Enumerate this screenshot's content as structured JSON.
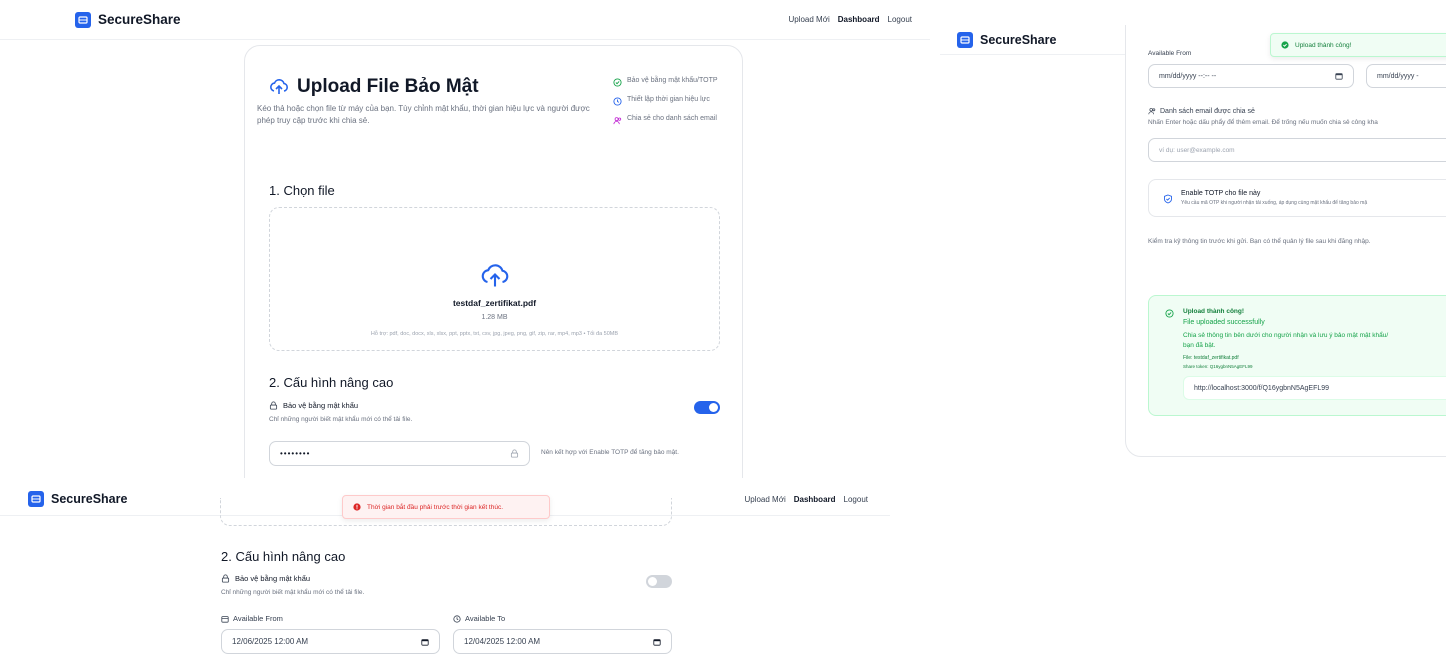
{
  "app": {
    "brand": "SecureShare"
  },
  "nav": {
    "upload": "Upload Mới",
    "dashboard": "Dashboard",
    "logout": "Logout"
  },
  "page": {
    "title": "Upload File Bảo Mật",
    "description": "Kéo thả hoặc chọn file từ máy của bạn. Tùy chỉnh mật khẩu, thời gian hiệu lực và người được phép truy cập trước khi chia sẻ.",
    "features": [
      {
        "icon": "shield-check-icon",
        "text": "Bảo vệ bằng mật khẩu/TOTP"
      },
      {
        "icon": "clock-icon",
        "text": "Thiết lập thời gian hiệu lực"
      },
      {
        "icon": "users-icon",
        "text": "Chia sẻ cho danh sách email"
      }
    ]
  },
  "file_section": {
    "heading": "1. Chọn file",
    "filename": "testdaf_zertifikat.pdf",
    "filesize": "1.28 MB",
    "support": "Hỗ trợ: pdf, doc, docx, xls, xlsx, ppt, pptx, txt, csv, jpg, jpeg, png, gif, zip, rar, mp4, mp3 • Tối đa 50MB"
  },
  "advanced": {
    "heading": "2. Cấu hình nâng cao",
    "password_label": "Bảo vệ bằng mật khẩu",
    "password_hint": "Chỉ những người biết mật khẩu mới có thể tải file.",
    "password_value": "••••••••",
    "password_tip": "Nên kết hợp với Enable TOTP để tăng bảo mật.",
    "password_enabled": true
  },
  "panel2": {
    "available_from_label": "Available From",
    "from_placeholder": "mm/dd/yyyy --:-- --",
    "to_placeholder": "mm/dd/yyyy -",
    "email_label": "Danh sách email được chia sẻ",
    "email_hint": "Nhấn Enter hoặc dấu phẩy để thêm email. Để trống nếu muốn chia sẻ công kha",
    "email_placeholder": "ví dụ: user@example.com",
    "totp_title": "Enable TOTP cho file này",
    "totp_desc": "Yêu cầu mã OTP khi người nhận tải xuống, áp dụng cùng mật khẩu để tăng bảo mậ",
    "review_note": "Kiểm tra kỹ thông tin trước khi gửi. Bạn có thể quản lý file sau khi đăng nhập.",
    "success": {
      "title": "Upload thành công!",
      "subtitle": "File uploaded successfully",
      "info": "Chia sẻ thông tin bên dưới cho người nhận và lưu ý bảo mật mật khẩu/",
      "info2": "bạn đã bật.",
      "file_line": "File: testdaf_zertifikat.pdf",
      "token_line": "Share token: Q16ygbnN5AgEFL99",
      "link": "http://localhost:3000/f/Q16ygbnN5AgEFL99"
    },
    "toast": "Upload thành công!"
  },
  "panel3": {
    "toast": "Thời gian bắt đầu phải trước thời gian kết thúc.",
    "heading": "2. Cấu hình nâng cao",
    "password_label": "Bảo vệ bằng mật khẩu",
    "password_hint": "Chỉ những người biết mật khẩu mới có thể tải file.",
    "password_enabled": false,
    "from_label": "Available From",
    "to_label": "Available To",
    "from_value": "12/06/2025 12:00 AM",
    "to_value": "12/04/2025 12:00 AM"
  },
  "colors": {
    "accent": "#2563eb",
    "success": "#16a34a",
    "error": "#dc2626"
  }
}
